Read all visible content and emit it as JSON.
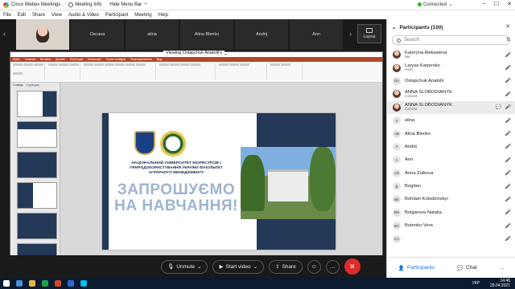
{
  "titlebar": {
    "app_title": "Cisco Webex Meetings",
    "meeting_info": "Meeting Info",
    "hide_menu": "Hide Menu Bar",
    "status": "Connected",
    "status_color": "#2eb82e"
  },
  "menu": [
    "File",
    "Edit",
    "Share",
    "View",
    "Audio & Video",
    "Participant",
    "Meeting",
    "Help"
  ],
  "video_tiles": [
    "Оксана",
    "alina",
    "Alina Blenko",
    "Andrij",
    "Ann"
  ],
  "layout_label": "Layout",
  "share": {
    "viewing_label": "Viewing Ostapchuk Anatolii's",
    "ppt_title": "Деп 28 вступникам - Microsoft PowerPoint",
    "ribbon_tabs": [
      "Файл",
      "Главная",
      "Вставка",
      "Дизайн",
      "Переходы",
      "Анимация",
      "Показ слайдов",
      "Рецензирование",
      "Вид"
    ],
    "panel_tabs": [
      "Слайды",
      "Структура"
    ],
    "notes_placeholder": "Заметки к слайду",
    "status_text": "Слайд 1 из 7   \"Office Theme\"   русский"
  },
  "slide": {
    "university": "НАЦІОНАЛЬНИЙ УНІВЕРСИТЕТ БІОРЕСУРСІВ І ПРИРОДОКОРИСТУВАННЯ УКРАЇНИ ФАКУЛЬТЕТ АГРАРНОГО МЕНЕДЖМЕНТУ",
    "invite": "ЗАПРОШУЄМО НА НАВЧАННЯ!",
    "brand_navy": "#243858",
    "invite_color": "#9db3d0"
  },
  "controls": {
    "unmute": "Unmute",
    "start_video": "Start video",
    "share": "Share",
    "end_color": "#e02b2b"
  },
  "participants": {
    "header": "Participants (100)",
    "search_placeholder": "Search",
    "list": [
      {
        "initials": "",
        "photo": true,
        "name": "Kateryna Alekseieva",
        "role": "Me"
      },
      {
        "initials": "",
        "photo": true,
        "name": "Larysa Karpenko",
        "role": "Host"
      },
      {
        "initials": "OA",
        "photo": false,
        "name": "Ostapchuk Anatolii",
        "role": ""
      },
      {
        "initials": "",
        "photo": true,
        "name": "ANNA SLOBODIANYK",
        "role": "Cohost"
      },
      {
        "initials": "",
        "photo": true,
        "name": "ANNA SLOBODIANYK",
        "role": "Cohost"
      },
      {
        "initials": "A",
        "photo": false,
        "name": "alina",
        "role": ""
      },
      {
        "initials": "AB",
        "photo": false,
        "name": "Alina Blenko",
        "role": ""
      },
      {
        "initials": "A",
        "photo": false,
        "name": "Andrij",
        "role": ""
      },
      {
        "initials": "A",
        "photo": false,
        "name": "Ann",
        "role": ""
      },
      {
        "initials": "AZ",
        "photo": false,
        "name": "Anna Zuikova",
        "role": ""
      },
      {
        "initials": "B",
        "photo": false,
        "name": "Bogdan",
        "role": ""
      },
      {
        "initials": "BK",
        "photo": false,
        "name": "Bohdan Kolodzinskyi",
        "role": ""
      },
      {
        "initials": "BN",
        "photo": false,
        "name": "Bolgarova Natalia",
        "role": ""
      },
      {
        "initials": "BV",
        "photo": false,
        "name": "Butenko Vera",
        "role": ""
      },
      {
        "initials": "CA",
        "photo": false,
        "name": "",
        "role": ""
      }
    ],
    "foot_participants": "Participants",
    "foot_chat": "Chat"
  },
  "taskbar": {
    "lang": "УКР",
    "time": "14:46",
    "date": "29.04.2021"
  }
}
